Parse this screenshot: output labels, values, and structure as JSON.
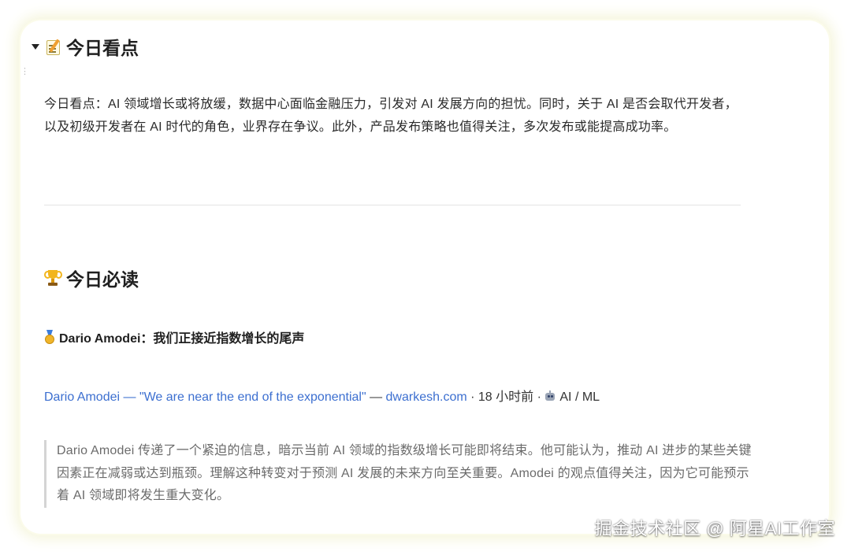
{
  "section1": {
    "heading": "今日看点",
    "icon": "memo-icon",
    "paragraph": "今日看点：AI 领域增长或将放缓，数据中心面临金融压力，引发对 AI 发展方向的担忧。同时，关于 AI 是否会取代开发者，以及初级开发者在 AI 时代的角色，业界存在争议。此外，产品发布策略也值得关注，多次发布或能提高成功率。"
  },
  "section2": {
    "heading": "今日必读",
    "icon": "trophy-icon",
    "article": {
      "icon": "medal-icon",
      "title": "Dario Amodei：我们正接近指数增长的尾声",
      "link_text": "Dario Amodei — \"We are near the end of the exponential\"",
      "dash": " — ",
      "source_link": "dwarkesh.com",
      "time": " · 18 小时前 · ",
      "category_icon": "robot-icon",
      "category": "AI / ML",
      "summary": "Dario Amodei 传递了一个紧迫的信息，暗示当前 AI 领域的指数级增长可能即将结束。他可能认为，推动 AI 进步的某些关键因素正在减弱或达到瓶颈。理解这种转变对于预测 AI 发展的未来方向至关重要。Amodei 的观点值得关注，因为它可能预示着 AI 领域即将发生重大变化。"
    }
  },
  "watermark": "掘金技术社区 @ 阿星AI工作室"
}
